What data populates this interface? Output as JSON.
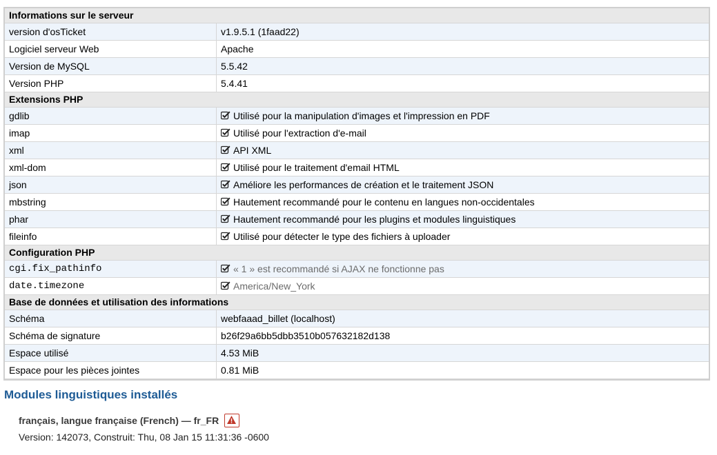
{
  "server": {
    "title": "Informations sur le serveur",
    "rows": [
      {
        "label": "version d'osTicket",
        "value": "v1.9.5.1 (1faad22)"
      },
      {
        "label": "Logiciel serveur Web",
        "value": "Apache"
      },
      {
        "label": "Version de MySQL",
        "value": "5.5.42"
      },
      {
        "label": "Version PHP",
        "value": "5.4.41"
      }
    ]
  },
  "extensions": {
    "title": "Extensions PHP",
    "rows": [
      {
        "label": "gdlib",
        "value": "Utilisé pour la manipulation d'images et l'impression en PDF"
      },
      {
        "label": "imap",
        "value": "Utilisé pour l'extraction d'e-mail"
      },
      {
        "label": "xml",
        "value": "API XML"
      },
      {
        "label": "xml-dom",
        "value": "Utilisé pour le traitement d'email HTML"
      },
      {
        "label": "json",
        "value": "Améliore les performances de création et le traitement JSON"
      },
      {
        "label": "mbstring",
        "value": "Hautement recommandé pour le contenu en langues non-occidentales"
      },
      {
        "label": "phar",
        "value": "Hautement recommandé pour les plugins et modules linguistiques"
      },
      {
        "label": "fileinfo",
        "value": "Utilisé pour détecter le type des fichiers à uploader"
      }
    ]
  },
  "config": {
    "title": "Configuration PHP",
    "rows": [
      {
        "label": "cgi.fix_pathinfo",
        "value": "« 1 » est recommandé si AJAX ne fonctionne pas"
      },
      {
        "label": "date.timezone",
        "value": "America/New_York"
      }
    ]
  },
  "database": {
    "title": "Base de données et utilisation des informations",
    "rows": [
      {
        "label": "Schéma",
        "value": "webfaaad_billet (localhost)"
      },
      {
        "label": "Schéma de signature",
        "value": "b26f29a6bb5dbb3510b057632182d138"
      },
      {
        "label": "Espace utilisé",
        "value": "4.53 MiB"
      },
      {
        "label": "Espace pour les pièces jointes",
        "value": "0.81 MiB"
      }
    ]
  },
  "modules": {
    "title": "Modules linguistiques installés",
    "lang_name": "français, langue française (French) — fr_FR",
    "lang_version": "Version: 142073, Construit: Thu, 08 Jan 15 11:31:36 -0600"
  },
  "icons": {
    "check": "check-square-icon",
    "warning": "warning-icon"
  },
  "colors": {
    "heading_blue": "#1e5b95",
    "row_alt": "#eef4fb",
    "section_header": "#e8e8e8",
    "warning_red": "#c0392b"
  }
}
